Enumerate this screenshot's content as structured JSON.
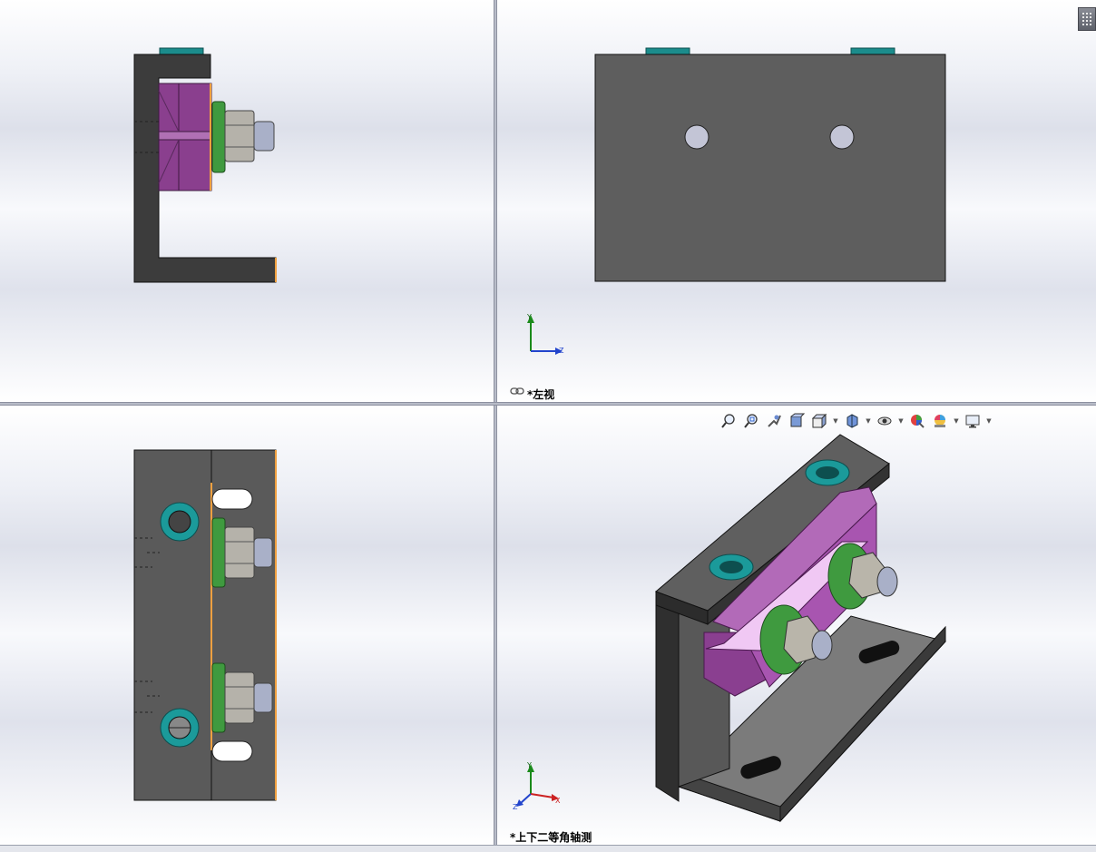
{
  "views": {
    "top_right": {
      "label": "*左视"
    },
    "bottom_right": {
      "label": "*上下二等角轴测"
    }
  },
  "triad": {
    "y": "Y",
    "z": "Z",
    "x": "X"
  },
  "toolbar": {
    "icons": [
      "zoom-to-fit-icon",
      "zoom-area-icon",
      "previous-view-icon",
      "section-view-icon",
      "view-orientation-icon",
      "display-style-icon",
      "hide-show-items-icon",
      "edit-appearance-icon",
      "apply-scene-icon",
      "view-settings-icon"
    ]
  },
  "colors": {
    "steel": "#5a5a5a",
    "purple": "#a05aa8",
    "green": "#3f9a3f",
    "teal": "#1aa0a0",
    "nut": "#b8b5ad"
  }
}
